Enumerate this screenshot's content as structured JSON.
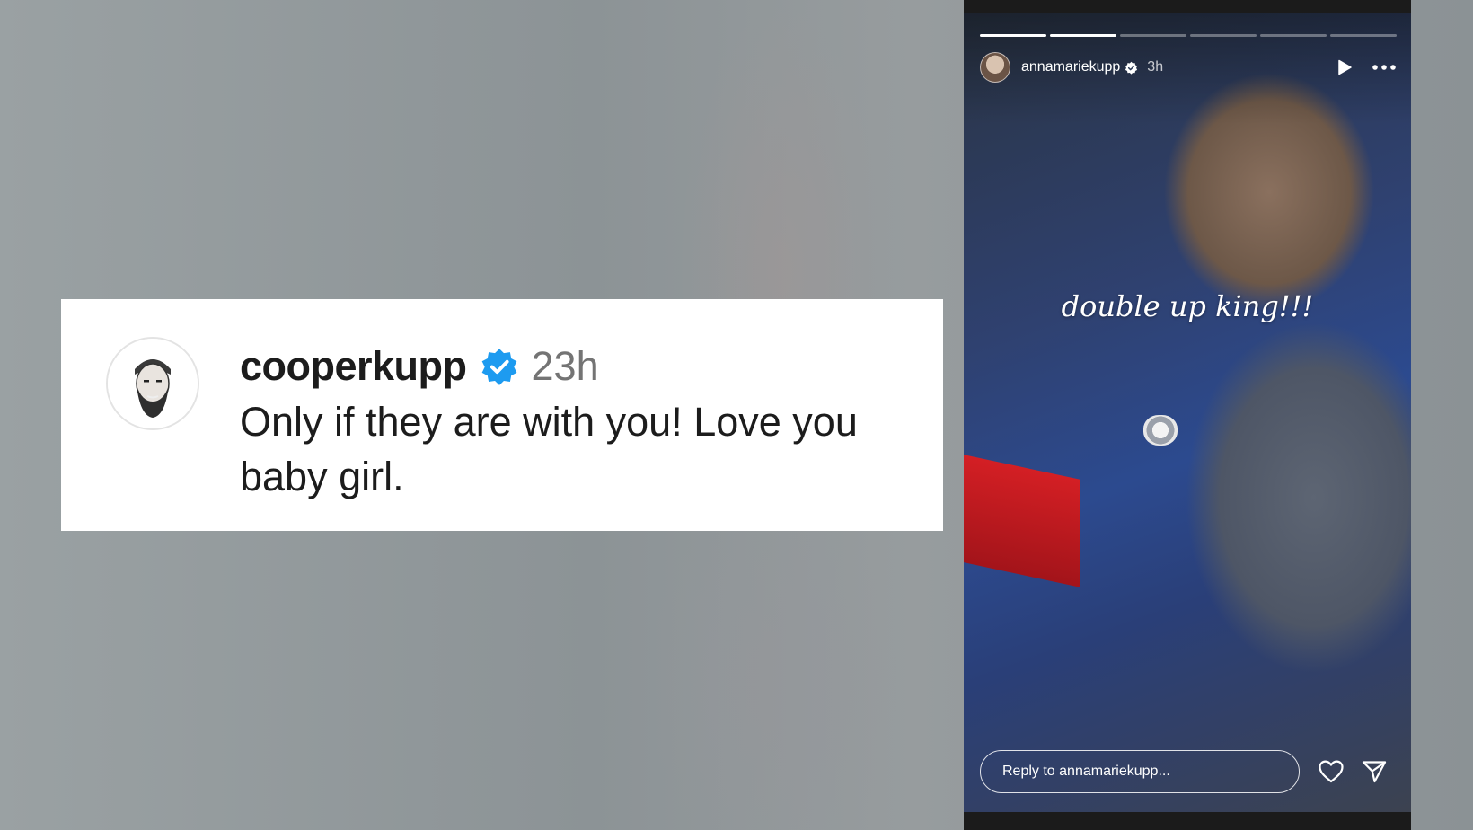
{
  "comment": {
    "username": "cooperkupp",
    "time": "23h",
    "text": "Only if they are with you! Love you baby girl.",
    "avatar_icon": "bearded-man-portrait-icon",
    "verified_icon": "verified-badge-icon",
    "verified_color": "#1d9bf0"
  },
  "story": {
    "progress_segments": [
      1,
      1,
      0,
      0,
      0,
      0
    ],
    "username": "annamariekupp",
    "time": "3h",
    "caption": "double up king!!!",
    "icons": {
      "play": "play-icon",
      "more": "more-options-icon",
      "like": "heart-icon",
      "share": "send-icon"
    },
    "reply_placeholder": "Reply to annamariekupp..."
  }
}
